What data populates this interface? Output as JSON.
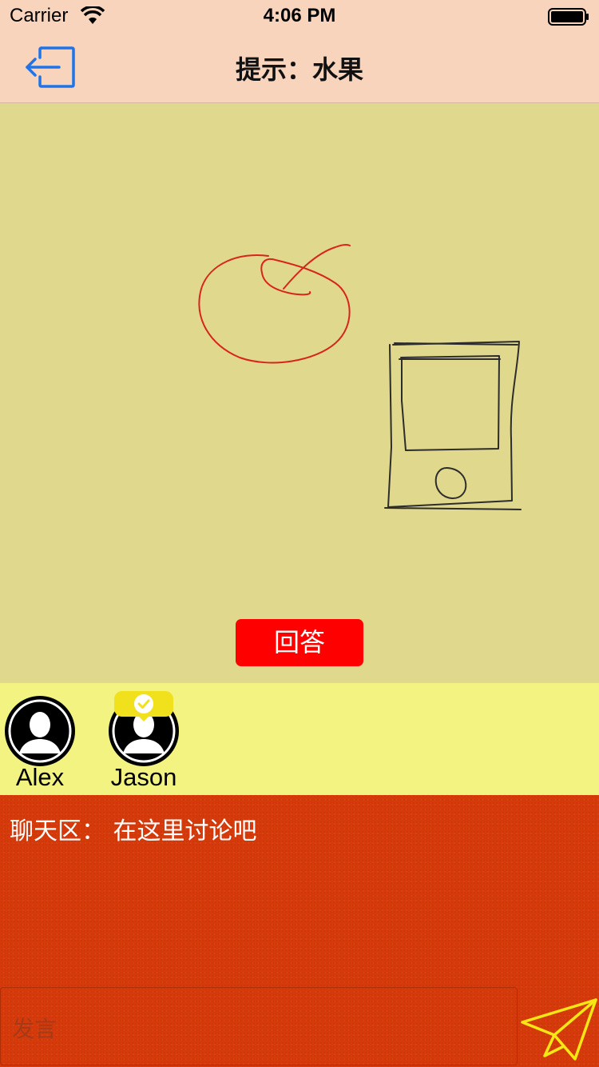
{
  "status_bar": {
    "carrier": "Carrier",
    "time": "4:06 PM",
    "icons": [
      "wifi-icon",
      "battery-icon"
    ]
  },
  "nav": {
    "back_icon": "exit-icon",
    "title": "提示：水果"
  },
  "canvas": {
    "answer_label": "回答",
    "answer_color": "#ff0000",
    "background": "#e0d88d"
  },
  "players": [
    {
      "name": "Alex",
      "has_check_badge": false
    },
    {
      "name": "Jason",
      "has_check_badge": true
    }
  ],
  "chat": {
    "hint": "聊天区：  在这里讨论吧",
    "input_placeholder": "发言",
    "send_icon": "paper-plane-icon",
    "background": "#d63a0b"
  }
}
